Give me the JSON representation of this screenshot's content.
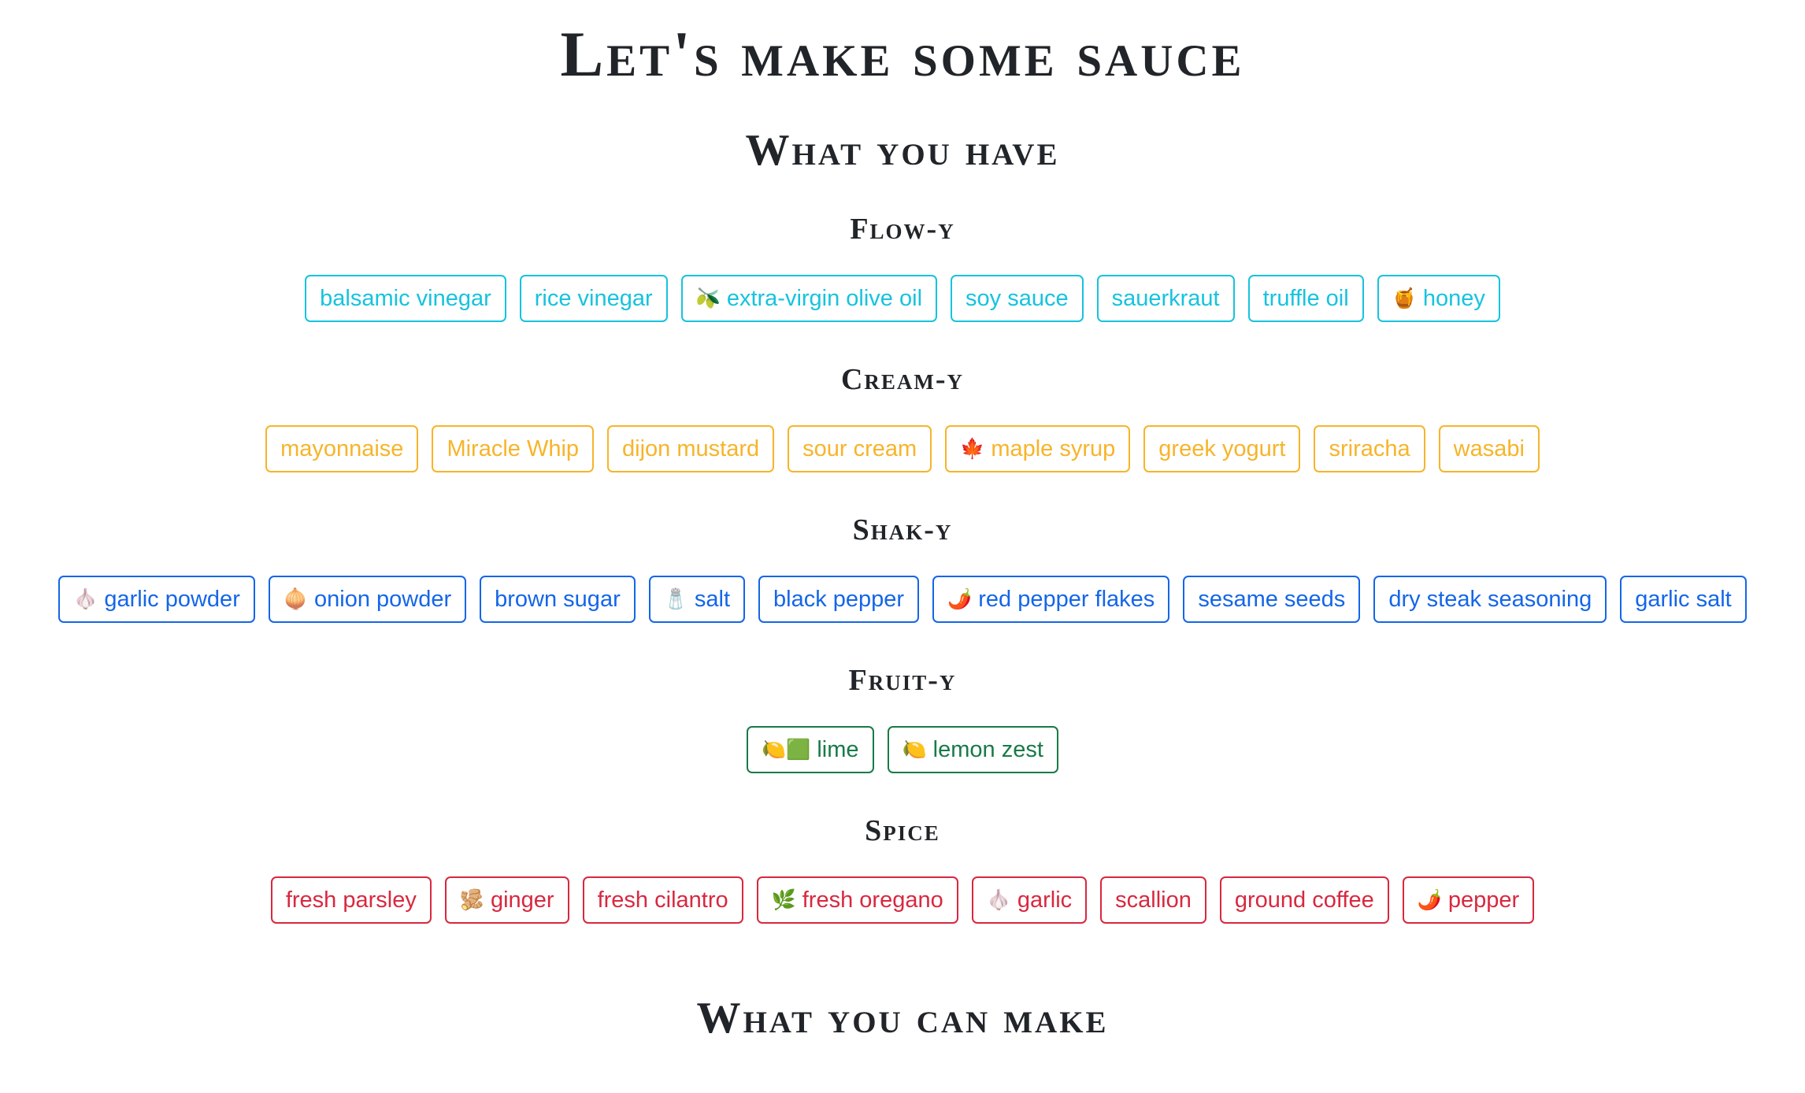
{
  "title": "Let's make some sauce",
  "have_heading": "What you have",
  "make_heading": "What you can make",
  "colors": {
    "flowy": "#16c3de",
    "creamy": "#f7b42a",
    "shaky": "#1466e8",
    "fruity": "#187a48",
    "spice": "#d8283f"
  },
  "categories": [
    {
      "key": "flowy",
      "name": "Flow-y",
      "items": [
        {
          "label": "balsamic vinegar",
          "emoji": ""
        },
        {
          "label": "rice vinegar",
          "emoji": ""
        },
        {
          "label": "extra-virgin olive oil",
          "emoji": "🫒"
        },
        {
          "label": "soy sauce",
          "emoji": ""
        },
        {
          "label": "sauerkraut",
          "emoji": ""
        },
        {
          "label": "truffle oil",
          "emoji": ""
        },
        {
          "label": "honey",
          "emoji": "🍯"
        }
      ]
    },
    {
      "key": "creamy",
      "name": "Cream-y",
      "items": [
        {
          "label": "mayonnaise",
          "emoji": ""
        },
        {
          "label": "Miracle Whip",
          "emoji": ""
        },
        {
          "label": "dijon mustard",
          "emoji": ""
        },
        {
          "label": "sour cream",
          "emoji": ""
        },
        {
          "label": "maple syrup",
          "emoji": "🍁"
        },
        {
          "label": "greek yogurt",
          "emoji": ""
        },
        {
          "label": "sriracha",
          "emoji": ""
        },
        {
          "label": "wasabi",
          "emoji": ""
        }
      ]
    },
    {
      "key": "shaky",
      "name": "Shak-y",
      "items": [
        {
          "label": "garlic powder",
          "emoji": "🧄"
        },
        {
          "label": "onion powder",
          "emoji": "🧅"
        },
        {
          "label": "brown sugar",
          "emoji": ""
        },
        {
          "label": "salt",
          "emoji": "🧂"
        },
        {
          "label": "black pepper",
          "emoji": ""
        },
        {
          "label": "red pepper flakes",
          "emoji": "🌶️"
        },
        {
          "label": "sesame seeds",
          "emoji": ""
        },
        {
          "label": "dry steak seasoning",
          "emoji": ""
        },
        {
          "label": "garlic salt",
          "emoji": ""
        }
      ]
    },
    {
      "key": "fruity",
      "name": "Fruit-y",
      "items": [
        {
          "label": "lime",
          "emoji": "🍋🟩"
        },
        {
          "label": "lemon zest",
          "emoji": "🍋"
        }
      ]
    },
    {
      "key": "spice",
      "name": "Spice",
      "items": [
        {
          "label": "fresh parsley",
          "emoji": ""
        },
        {
          "label": "ginger",
          "emoji": "🫚"
        },
        {
          "label": "fresh cilantro",
          "emoji": ""
        },
        {
          "label": "fresh oregano",
          "emoji": "🌿"
        },
        {
          "label": "garlic",
          "emoji": "🧄"
        },
        {
          "label": "scallion",
          "emoji": ""
        },
        {
          "label": "ground coffee",
          "emoji": ""
        },
        {
          "label": "pepper",
          "emoji": "🌶️"
        }
      ]
    }
  ]
}
